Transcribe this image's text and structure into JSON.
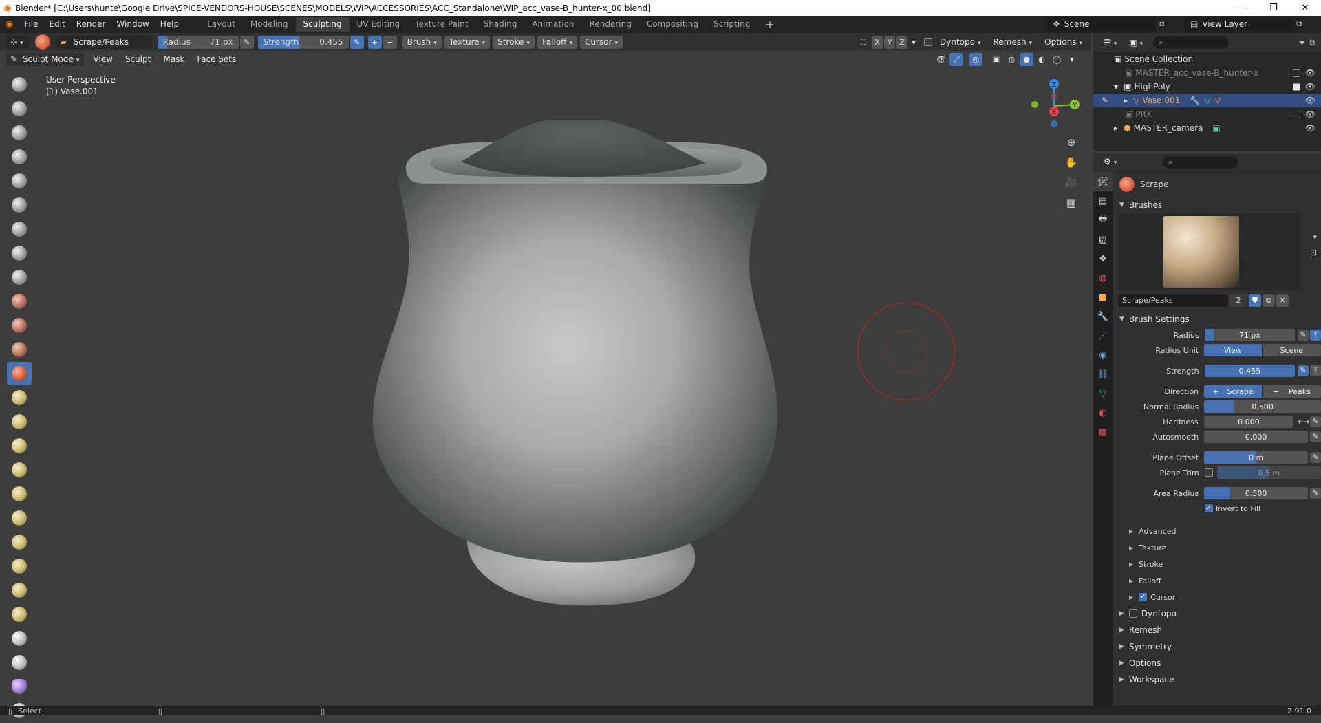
{
  "window": {
    "title": "Blender* [C:\\Users\\hunte\\Google Drive\\SPICE-VENDORS-HOUSE\\SCENES\\MODELS\\WIP\\ACCESSORIES\\ACC_Standalone\\WIP_acc_vase-B_hunter-x_00.blend]",
    "minimize": "—",
    "maximize": "❐",
    "close": "✕"
  },
  "menu": [
    "File",
    "Edit",
    "Render",
    "Window",
    "Help"
  ],
  "workspaces": [
    "Layout",
    "Modeling",
    "Sculpting",
    "UV Editing",
    "Texture Paint",
    "Shading",
    "Animation",
    "Rendering",
    "Compositing",
    "Scripting"
  ],
  "active_workspace": "Sculpting",
  "add_workspace": "+",
  "scene": {
    "label": "Scene"
  },
  "view_layer": {
    "label": "View Layer"
  },
  "header": {
    "brush_name": "Scrape/Peaks",
    "radius_label": "Radius",
    "radius_value": "71 px",
    "strength_label": "Strength",
    "strength_value": "0.455",
    "plus": "+",
    "minus": "−",
    "menus": [
      "Brush",
      "Texture",
      "Stroke",
      "Falloff",
      "Cursor"
    ],
    "axes": [
      "X",
      "Y",
      "Z"
    ],
    "dyntopo": "Dyntopo",
    "remesh": "Remesh",
    "options": "Options"
  },
  "subheader": {
    "mode": "Sculpt Mode",
    "menus": [
      "View",
      "Sculpt",
      "Mask",
      "Face Sets"
    ]
  },
  "viewport": {
    "perspective": "User Perspective",
    "object": "(1) Vase.001",
    "gizmo_x": "X",
    "gizmo_y": "Y",
    "gizmo_z": "Z"
  },
  "outliner": {
    "items": [
      {
        "name": "Scene Collection",
        "indent": 0
      },
      {
        "name": "MASTER_acc_vase-B_hunter-x",
        "indent": 1,
        "dim": true
      },
      {
        "name": "HighPoly",
        "indent": 1
      },
      {
        "name": "Vase.001",
        "indent": 2,
        "selected": true
      },
      {
        "name": "PRX",
        "indent": 1,
        "dim": true
      },
      {
        "name": "MASTER_camera",
        "indent": 1
      }
    ]
  },
  "properties": {
    "active_tool": "Scrape",
    "brushes_panel": "Brushes",
    "brush_datablock": "Scrape/Peaks",
    "brush_users": "2",
    "brush_settings_panel": "Brush Settings",
    "radius_label": "Radius",
    "radius_value": "71 px",
    "radius_fraction": 0.1,
    "radius_unit_label": "Radius Unit",
    "radius_unit_view": "View",
    "radius_unit_scene": "Scene",
    "strength_label": "Strength",
    "strength_value": "0.455",
    "strength_fraction": 0.455,
    "direction_label": "Direction",
    "direction_scrape": "Scrape",
    "direction_peaks": "Peaks",
    "normal_radius_label": "Normal Radius",
    "normal_radius_value": "0.500",
    "normal_radius_fraction": 0.25,
    "hardness_label": "Hardness",
    "hardness_value": "0.000",
    "autosmooth_label": "Autosmooth",
    "autosmooth_value": "0.000",
    "plane_offset_label": "Plane Offset",
    "plane_offset_value": "0 m",
    "plane_offset_fraction": 0.5,
    "plane_trim_label": "Plane Trim",
    "plane_trim_value": "0.5 m",
    "area_radius_label": "Area Radius",
    "area_radius_value": "0.500",
    "area_radius_fraction": 0.25,
    "invert_to_fill": "Invert to Fill",
    "subpanels": [
      "Advanced",
      "Texture",
      "Stroke",
      "Falloff",
      "Cursor"
    ],
    "panels": [
      "Dyntopo",
      "Remesh",
      "Symmetry",
      "Options",
      "Workspace"
    ]
  },
  "statusbar": {
    "select": "Select",
    "version": "2.91.0"
  },
  "colors": {
    "accent": "#4772b3",
    "viewport_bg": "#3d3d3d",
    "brush_circle": "#d11d1d",
    "selected_row": "#334d80",
    "axis_x": "#e04050",
    "axis_y": "#8ac230",
    "axis_z": "#3b8be3"
  }
}
